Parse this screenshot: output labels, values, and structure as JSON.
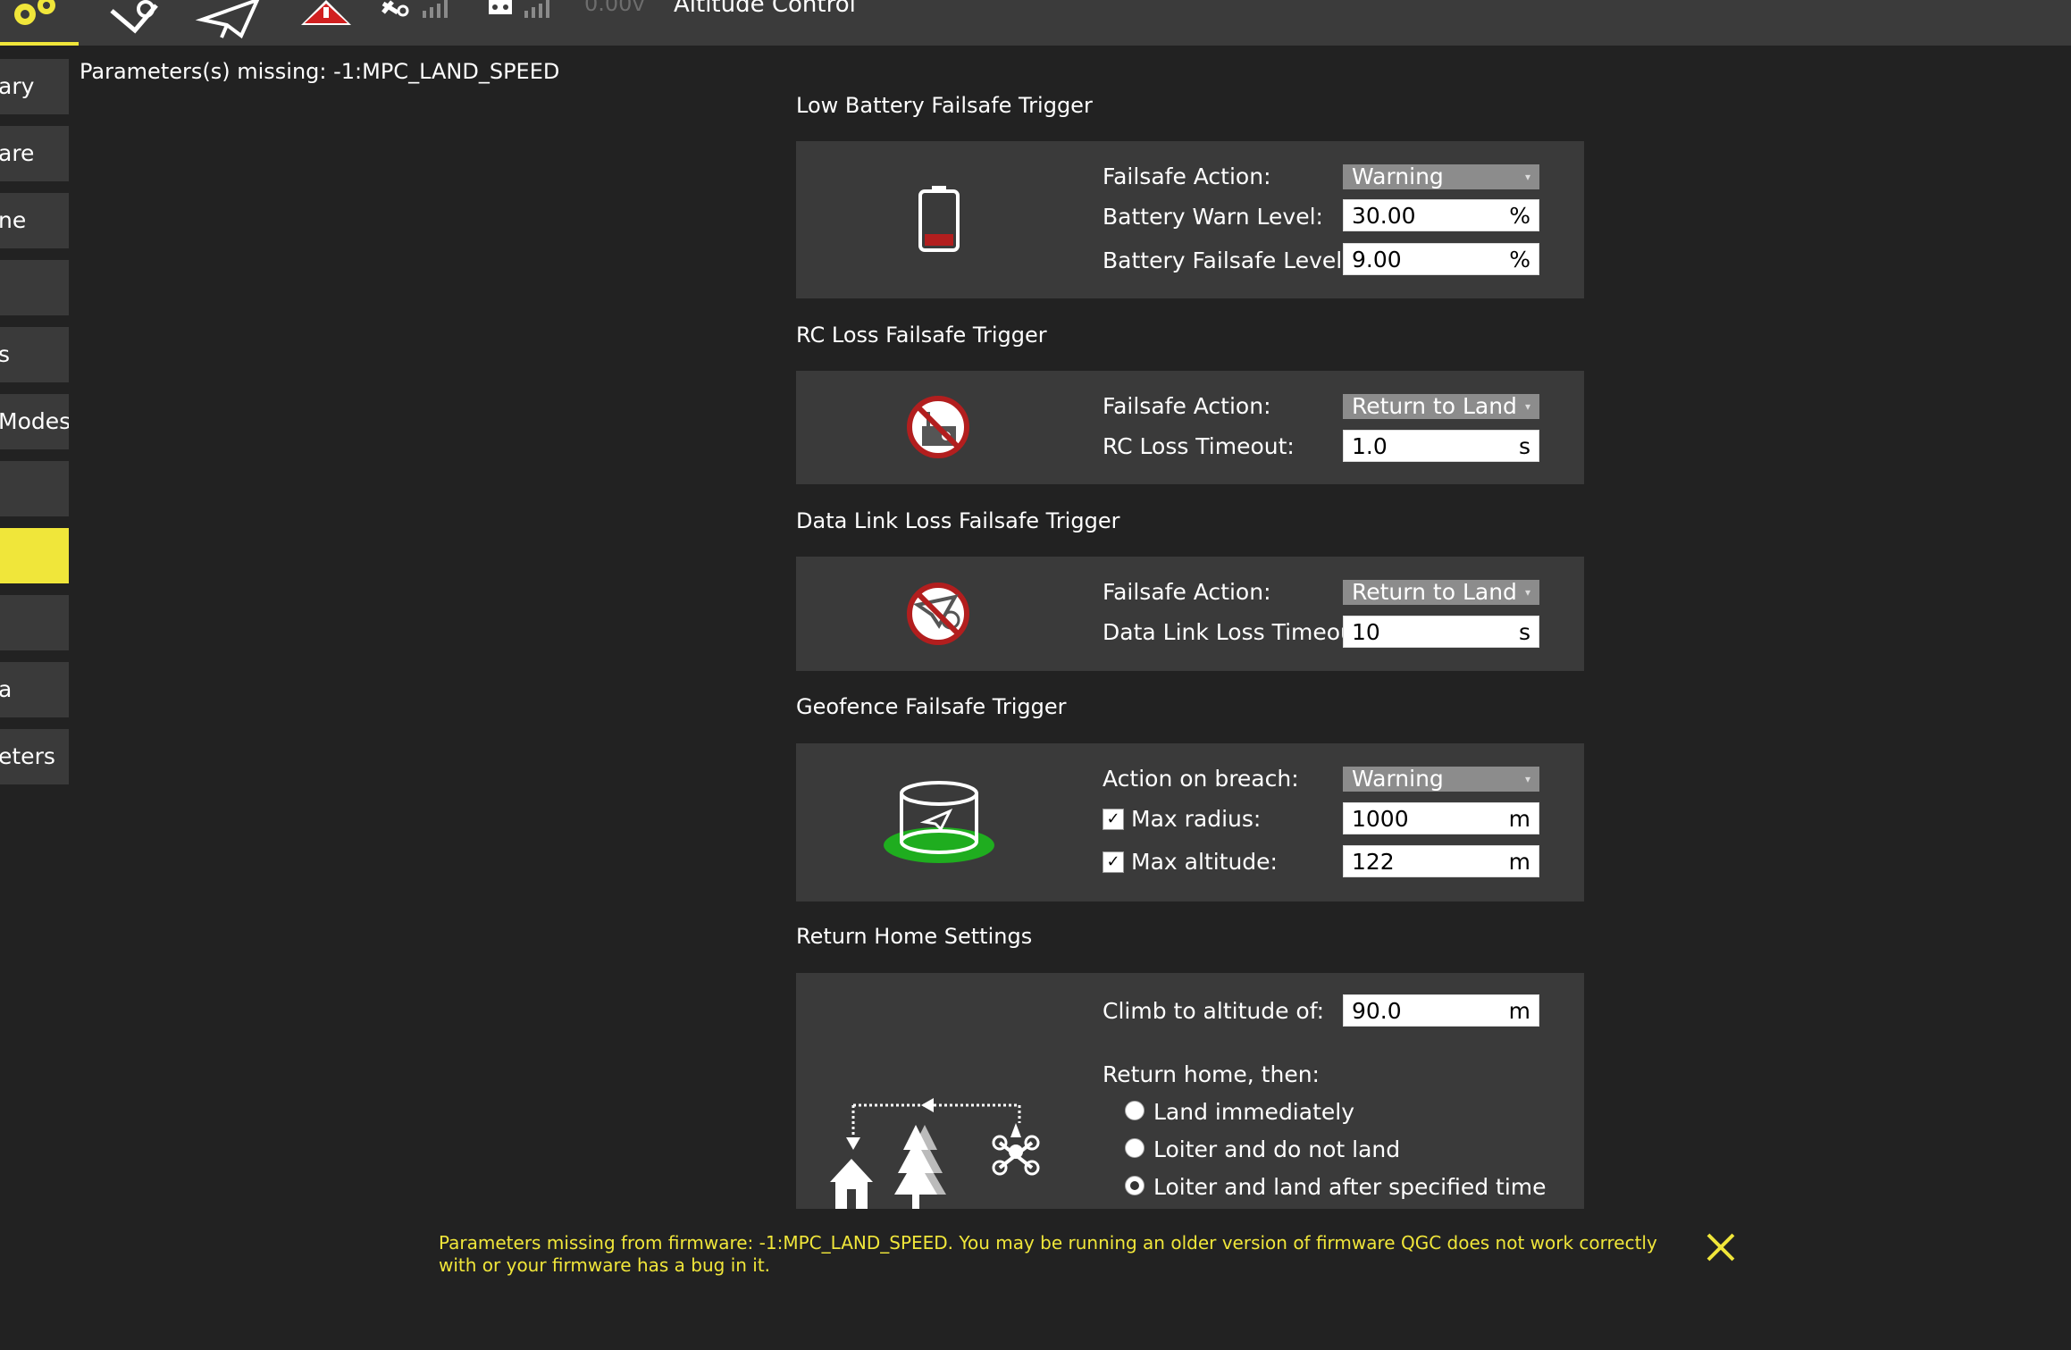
{
  "toolbar": {
    "voltage": "0.00v",
    "flight_mode": "Altitude Control",
    "accent_color": "#f0e63a"
  },
  "sidebar": {
    "items": [
      {
        "label": "ary"
      },
      {
        "label": "are"
      },
      {
        "label": "ne"
      },
      {
        "label": ""
      },
      {
        "label": "s"
      },
      {
        "label": "Modes"
      },
      {
        "label": ""
      },
      {
        "label": ""
      },
      {
        "label": ""
      },
      {
        "label": "a"
      },
      {
        "label": "eters"
      }
    ],
    "active_index": 7
  },
  "missing_header": "Parameters(s) missing: -1:MPC_LAND_SPEED",
  "battery": {
    "title": "Low Battery Failsafe Trigger",
    "action_label": "Failsafe Action:",
    "action_value": "Warning",
    "warn_label": "Battery Warn Level:",
    "warn_value": "30.00",
    "warn_unit": "%",
    "failsafe_label": "Battery Failsafe Level:",
    "failsafe_value": "9.00",
    "failsafe_unit": "%"
  },
  "rc_loss": {
    "title": "RC Loss Failsafe Trigger",
    "action_label": "Failsafe Action:",
    "action_value": "Return to Land",
    "timeout_label": "RC Loss Timeout:",
    "timeout_value": "1.0",
    "timeout_unit": "s"
  },
  "data_link": {
    "title": "Data Link Loss Failsafe Trigger",
    "action_label": "Failsafe Action:",
    "action_value": "Return to Land",
    "timeout_label": "Data Link Loss Timeout:",
    "timeout_value": "10",
    "timeout_unit": "s"
  },
  "geofence": {
    "title": "Geofence Failsafe Trigger",
    "action_label": "Action on breach:",
    "action_value": "Warning",
    "radius_label": "Max radius:",
    "radius_checked": true,
    "radius_value": "1000",
    "radius_unit": "m",
    "altitude_label": "Max altitude:",
    "altitude_checked": true,
    "altitude_value": "122",
    "altitude_unit": "m"
  },
  "return_home": {
    "title": "Return Home Settings",
    "climb_label": "Climb to altitude of:",
    "climb_value": "90.0",
    "climb_unit": "m",
    "then_label": "Return home, then:",
    "options": [
      {
        "label": "Land immediately",
        "checked": false
      },
      {
        "label": "Loiter and do not land",
        "checked": false
      },
      {
        "label": "Loiter and land after specified time",
        "checked": true
      }
    ]
  },
  "message": {
    "text": "Parameters missing from firmware: -1:MPC_LAND_SPEED. You may be running an older version of firmware QGC does not work correctly with or your firmware has a bug in it.",
    "close_icon": "close-icon"
  },
  "check_mark": "✓"
}
